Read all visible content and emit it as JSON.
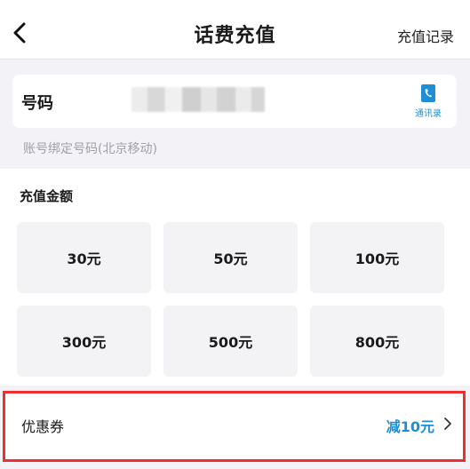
{
  "header": {
    "title": "话费充值",
    "history_label": "充值记录"
  },
  "phone": {
    "label": "号码",
    "value": "",
    "contacts_label": "通讯录",
    "hint": "账号绑定号码(北京移动)"
  },
  "amount": {
    "title": "充值金额",
    "options": [
      "30元",
      "50元",
      "100元",
      "300元",
      "500元",
      "800元"
    ]
  },
  "coupon": {
    "label": "优惠券",
    "value": "减10元"
  },
  "colors": {
    "accent": "#1e8fd6",
    "highlight_border": "#ee2f2f",
    "background": "#f2f2f7"
  },
  "icons": {
    "back": "chevron-left-icon",
    "contacts": "contacts-book-icon",
    "coupon_arrow": "chevron-right-icon"
  }
}
